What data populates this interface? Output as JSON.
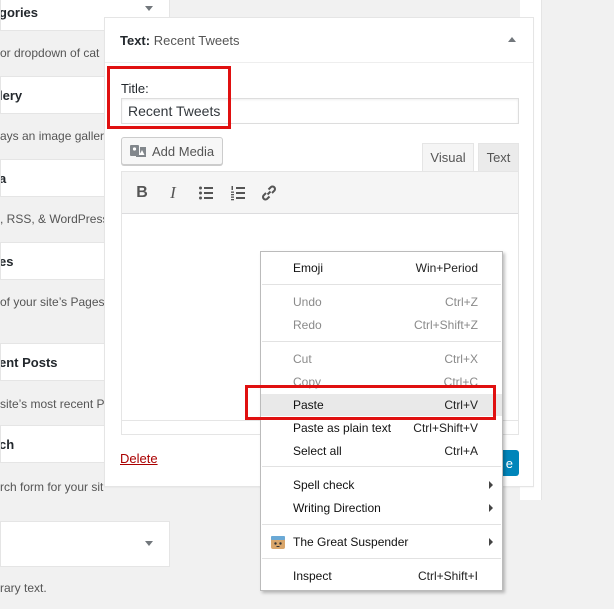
{
  "left_widgets": [
    {
      "title": "gories",
      "desc": "or dropdown of cat"
    },
    {
      "title": "lery",
      "desc": "ays an image gallery"
    },
    {
      "title": "a",
      "desc": ", RSS, & WordPress"
    },
    {
      "title": "es",
      "desc": " of your site’s Pages"
    },
    {
      "title": "ent Posts",
      "desc": "site’s most recent Po"
    },
    {
      "title": "ch",
      "desc": "rch form for your sit"
    }
  ],
  "bottom_desc": "rary text.",
  "widget": {
    "header_label": "Text:",
    "header_name": "Recent Tweets",
    "title_label": "Title:",
    "title_value": "Recent Tweets",
    "add_media_label": "Add Media",
    "tab_visual": "Visual",
    "tab_text": "Text",
    "toolbar": [
      "B",
      "I",
      "bulleted-list-icon",
      "numbered-list-icon",
      "link-icon"
    ],
    "delete_label": "Delete",
    "save_label": "e"
  },
  "context_menu": {
    "items": [
      {
        "label": "Emoji",
        "shortcut": "Win+Period",
        "disabled": false
      },
      {
        "label": "Undo",
        "shortcut": "Ctrl+Z",
        "disabled": true
      },
      {
        "label": "Redo",
        "shortcut": "Ctrl+Shift+Z",
        "disabled": true
      },
      {
        "label": "Cut",
        "shortcut": "Ctrl+X",
        "disabled": true
      },
      {
        "label": "Copy",
        "shortcut": "Ctrl+C",
        "disabled": true
      },
      {
        "label": "Paste",
        "shortcut": "Ctrl+V",
        "disabled": false,
        "highlighted": true
      },
      {
        "label": "Paste as plain text",
        "shortcut": "Ctrl+Shift+V",
        "disabled": false
      },
      {
        "label": "Select all",
        "shortcut": "Ctrl+A",
        "disabled": false
      },
      {
        "label": "Spell check",
        "shortcut": "",
        "submenu": true
      },
      {
        "label": "Writing Direction",
        "shortcut": "",
        "submenu": true
      },
      {
        "label": "The Great Suspender",
        "shortcut": "",
        "submenu": true,
        "icon": "suspender-extension-icon"
      },
      {
        "label": "Inspect",
        "shortcut": "Ctrl+Shift+I",
        "disabled": false
      }
    ]
  },
  "colors": {
    "highlight_red": "#e01010",
    "delete_red": "#a00000",
    "primary_blue": "#0085ba"
  }
}
